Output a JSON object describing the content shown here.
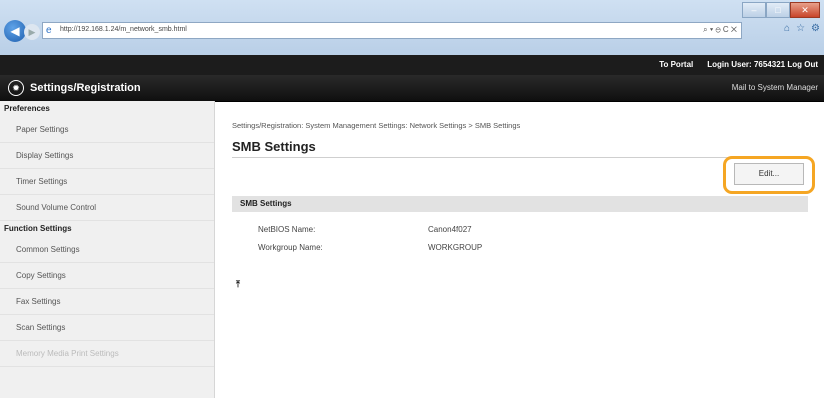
{
  "browser": {
    "url": "http://192.168.1.24/m_network_smb.html",
    "search_tools": "⌕ ▾ ⊖ C ✕",
    "win_minimize": "–",
    "win_maximize": "□",
    "win_close": "✕"
  },
  "header": {
    "to_portal": "To Portal",
    "login_label": "Login User:",
    "login_user": "7654321",
    "logout": "Log Out",
    "app_title": "Settings/Registration",
    "mail_link": "Mail to System Manager"
  },
  "sidebar": {
    "sections": [
      {
        "heading": "Preferences",
        "items": [
          "Paper Settings",
          "Display Settings",
          "Timer Settings",
          "Sound Volume Control"
        ]
      },
      {
        "heading": "Function Settings",
        "items": [
          "Common Settings",
          "Copy Settings",
          "Fax Settings",
          "Scan Settings",
          "Memory Media Print Settings"
        ]
      }
    ]
  },
  "main": {
    "breadcrumb": "Settings/Registration: System Management Settings: Network Settings > SMB Settings",
    "title": "SMB Settings",
    "edit_label": "Edit...",
    "section_title": "SMB Settings",
    "fields": [
      {
        "label": "NetBIOS Name:",
        "value": "Canon4f027"
      },
      {
        "label": "Workgroup Name:",
        "value": "WORKGROUP"
      }
    ],
    "top_link": "⤒"
  },
  "colors": {
    "highlight": "#f5a623",
    "header_bg": "#1c1c1c",
    "chrome_bg": "#c4d8ee"
  }
}
